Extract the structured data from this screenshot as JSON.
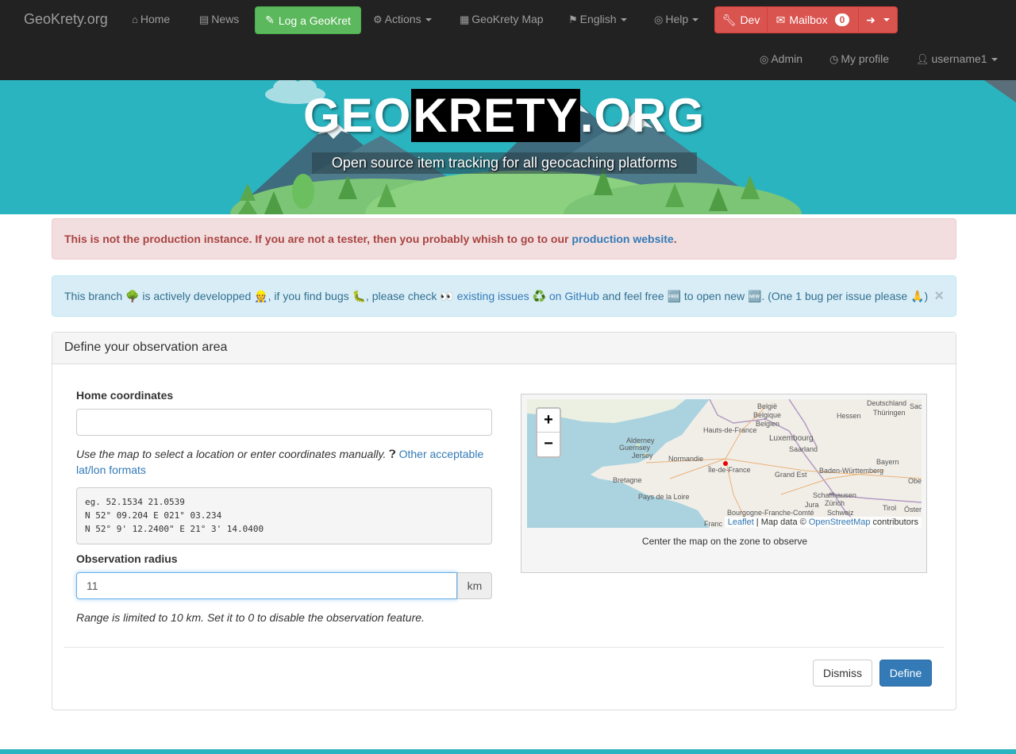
{
  "navbar": {
    "brand": "GeoKrety.org",
    "home": "Home",
    "news": "News",
    "log_button": "Log a GeoKret",
    "actions": "Actions",
    "map": "GeoKrety Map",
    "language": "English",
    "help": "Help",
    "dev": "Dev",
    "mailbox": "Mailbox",
    "mailbox_count": "0",
    "admin": "Admin",
    "profile": "My profile",
    "username": "username1"
  },
  "banner": {
    "title_pre": "GEO",
    "title_hl": "KRETY",
    "title_post": ".ORG",
    "subtitle": "Open source item tracking for all geocaching platforms"
  },
  "alert_danger": {
    "text": "This is not the production instance. If you are not a tester, then you probably whish to go to our ",
    "link": "production website",
    "suffix": "."
  },
  "alert_info": {
    "t1": "This branch 🌳 is actively developped 👷, if you find bugs 🐛, please check 👀 ",
    "link": "existing issues ♻️ on GitHub",
    "t2": " and feel free 🆓 to open new 🆕. (One 1 bug per issue please 🙏)",
    "close": "×"
  },
  "panel": {
    "title": "Define your observation area",
    "home_label": "Home coordinates",
    "home_value": "",
    "help_text": "Use the map to select a location or enter coordinates manually.",
    "help_link": "Other acceptable lat/lon formats",
    "examples": [
      "eg. 52.1534 21.0539",
      "N 52° 09.204 E 021° 03.234",
      "N 52° 9' 12.2400\" E 21° 3' 14.0400"
    ],
    "radius_label": "Observation radius",
    "radius_value": "11",
    "radius_unit": "km",
    "radius_help": "Range is limited to 10 km. Set it to 0 to disable the observation feature.",
    "map_caption": "Center the map on the zone to observe",
    "dismiss": "Dismiss",
    "define": "Define"
  },
  "map": {
    "zoom_in": "+",
    "zoom_out": "−",
    "attrib_leaflet": "Leaflet",
    "attrib_mid": " | Map data © ",
    "attrib_osm": "OpenStreetMap",
    "attrib_end": " contributors",
    "labels": [
      "Deutschland",
      "België",
      "Belgique",
      "Belgien",
      "Hessen",
      "Thüringen",
      "Luxembourg",
      "Hauts-de-France",
      "Saarland",
      "Alderney",
      "Guernsey",
      "Jersey",
      "Normandie",
      "Île-de-France",
      "Grand Est",
      "Baden-Württemberg",
      "Bayern",
      "Bretagne",
      "Pays de la Loire",
      "Schaffhausen",
      "Zürich",
      "Jura",
      "Schweiz",
      "Bourgogne-Franche-Comté",
      "Tirol",
      "Öster",
      "Obe",
      "Sac",
      "Franc"
    ]
  },
  "colors": {
    "navbar_bg": "#222222",
    "banner_bg": "#2ab4c0",
    "success": "#5cb85c",
    "danger": "#d9534f",
    "primary": "#337ab7"
  }
}
